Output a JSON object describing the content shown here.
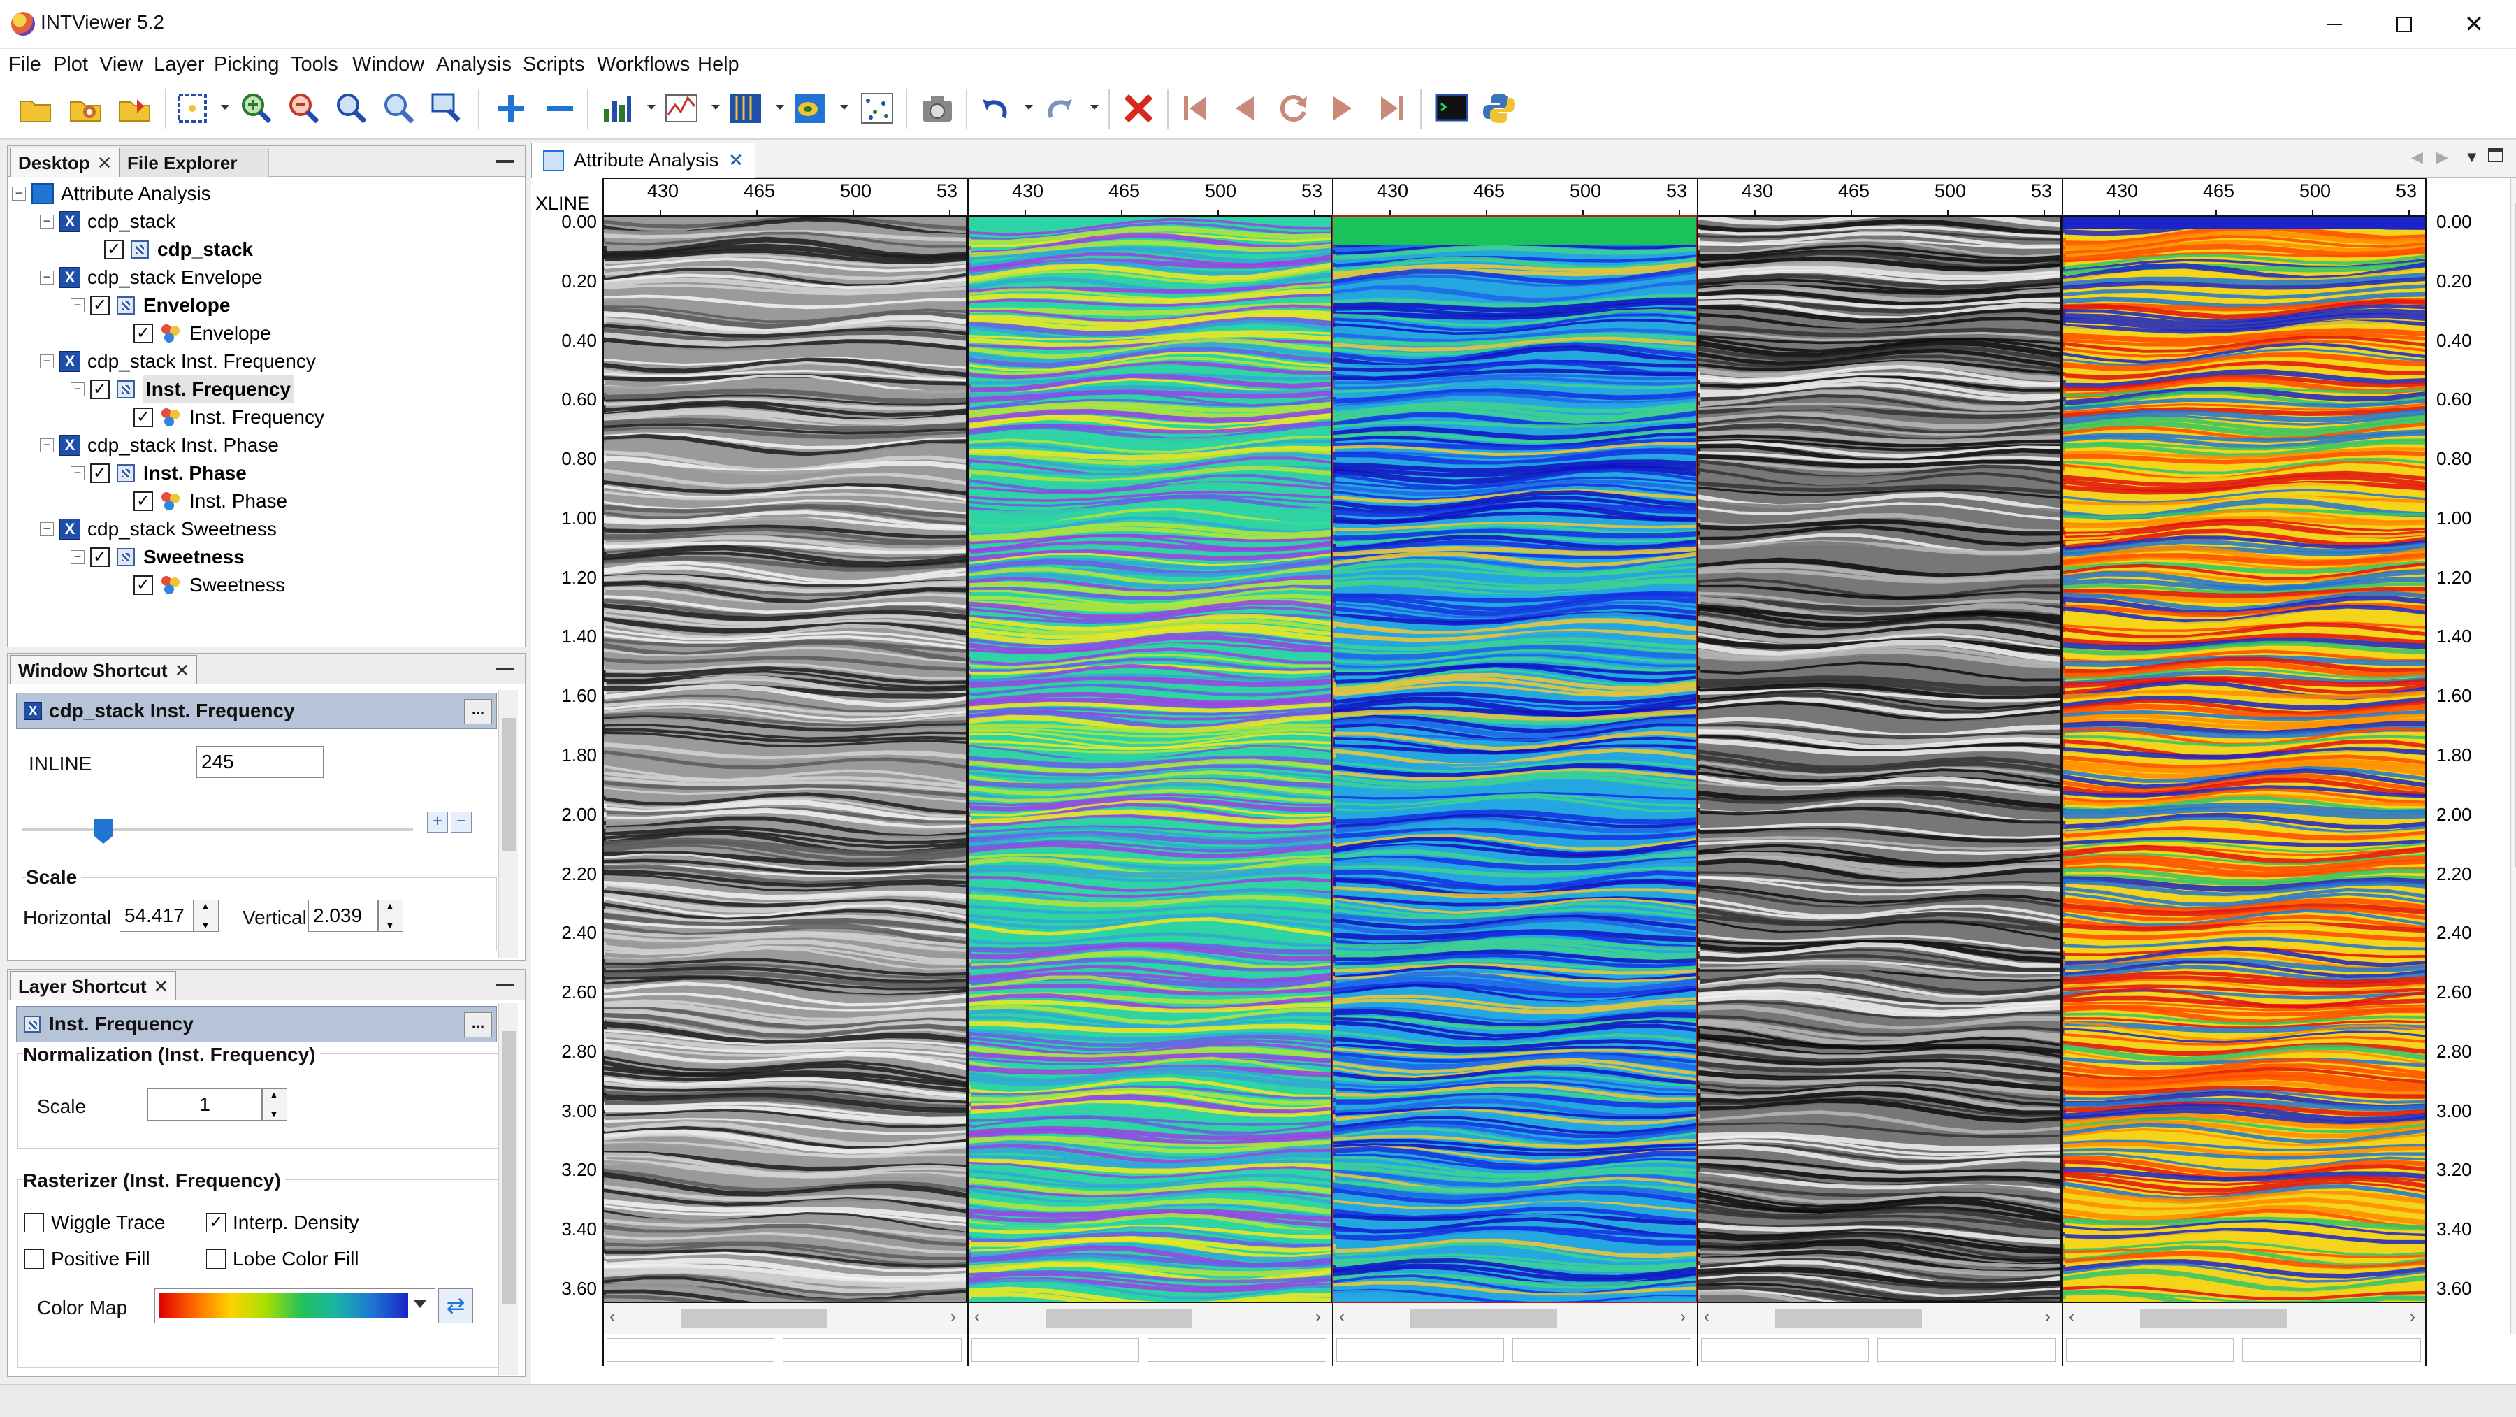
{
  "app": {
    "title": "INTViewer 5.2",
    "accent": "#1f4fa8"
  },
  "menu": [
    "File",
    "Plot",
    "View",
    "Layer",
    "Picking",
    "Tools",
    "Window",
    "Analysis",
    "Scripts",
    "Workflows",
    "Help"
  ],
  "desktop_panel": {
    "tabs": [
      "Desktop",
      "File Explorer"
    ],
    "tree": {
      "root": "Attribute Analysis",
      "windows": [
        {
          "name": "cdp_stack",
          "layers": [
            {
              "name": "cdp_stack",
              "checked": true,
              "bold": true
            }
          ]
        },
        {
          "name": "cdp_stack Envelope",
          "layers": [
            {
              "name": "Envelope",
              "checked": true,
              "bold": true,
              "child": "Envelope"
            }
          ]
        },
        {
          "name": "cdp_stack Inst. Frequency",
          "layers": [
            {
              "name": "Inst. Frequency",
              "checked": true,
              "bold": true,
              "selected": true,
              "child": "Inst. Frequency"
            }
          ]
        },
        {
          "name": "cdp_stack Inst. Phase",
          "layers": [
            {
              "name": "Inst. Phase",
              "checked": true,
              "bold": true,
              "child": "Inst. Phase"
            }
          ]
        },
        {
          "name": "cdp_stack Sweetness",
          "layers": [
            {
              "name": "Sweetness",
              "checked": true,
              "bold": true,
              "child": "Sweetness"
            }
          ]
        }
      ]
    }
  },
  "window_shortcut": {
    "tab": "Window Shortcut",
    "header": "cdp_stack Inst. Frequency",
    "inline_label": "INLINE",
    "inline_value": "245",
    "slider_fraction": 0.2,
    "scale_title": "Scale",
    "horizontal_label": "Horizontal",
    "horizontal_value": "54.417",
    "vertical_label": "Vertical",
    "vertical_value": "2.039",
    "dots": "..."
  },
  "layer_shortcut": {
    "tab": "Layer Shortcut",
    "header": "Inst. Frequency",
    "normalization_title": "Normalization (Inst. Frequency)",
    "scale_label": "Scale",
    "scale_value": "1",
    "rasterizer_title": "Rasterizer (Inst. Frequency)",
    "options": [
      {
        "label": "Wiggle Trace",
        "checked": false
      },
      {
        "label": "Interp. Density",
        "checked": true
      },
      {
        "label": "Positive Fill",
        "checked": false
      },
      {
        "label": "Lobe Color Fill",
        "checked": false
      }
    ],
    "colormap_label": "Color Map",
    "dots": "..."
  },
  "document": {
    "tab": "Attribute Analysis",
    "xline_label": "XLINE",
    "x_ticks": [
      "430",
      "465",
      "500",
      "53"
    ],
    "time_ticks": [
      "0.00",
      "0.20",
      "0.40",
      "0.60",
      "0.80",
      "1.00",
      "1.20",
      "1.40",
      "1.60",
      "1.80",
      "2.00",
      "2.20",
      "2.40",
      "2.60",
      "2.80",
      "3.00",
      "3.20",
      "3.40",
      "3.60"
    ],
    "panels": [
      {
        "name": "cdp_stack",
        "palette": "gray"
      },
      {
        "name": "Envelope",
        "palette": "viridis-purple"
      },
      {
        "name": "Inst. Frequency",
        "palette": "blue-green",
        "selected": true
      },
      {
        "name": "Inst. Phase",
        "palette": "gray-phase"
      },
      {
        "name": "Sweetness",
        "palette": "red-blue"
      }
    ]
  }
}
